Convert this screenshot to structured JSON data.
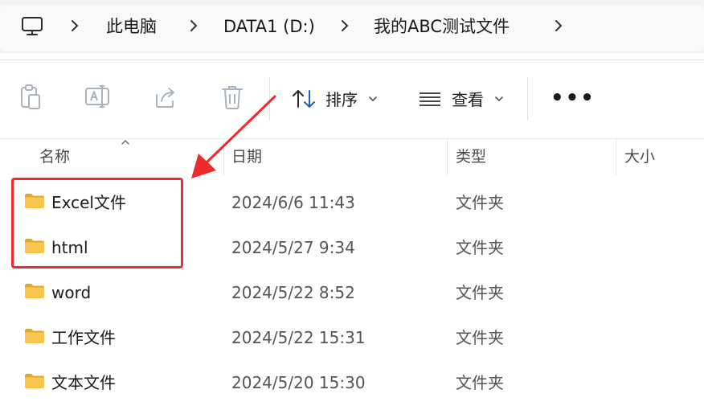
{
  "breadcrumb": {
    "items": [
      "此电脑",
      "DATA1 (D:)",
      "我的ABC测试文件"
    ]
  },
  "toolbar": {
    "sort_label": "排序",
    "view_label": "查看",
    "more_label": "•••"
  },
  "columns": {
    "name": "名称",
    "date": "日期",
    "type": "类型",
    "size": "大小"
  },
  "files": [
    {
      "name": "Excel文件",
      "date": "2024/6/6 11:43",
      "type": "文件夹"
    },
    {
      "name": "html",
      "date": "2024/5/27 9:34",
      "type": "文件夹"
    },
    {
      "name": "word",
      "date": "2024/5/22 8:52",
      "type": "文件夹"
    },
    {
      "name": "工作文件",
      "date": "2024/5/22 15:31",
      "type": "文件夹"
    },
    {
      "name": "文本文件",
      "date": "2024/5/20 15:30",
      "type": "文件夹"
    }
  ],
  "colors": {
    "folder": "#f6c64e",
    "folder_tab": "#e3a82b",
    "annotation": "#ee2a2a",
    "disabled_icon": "#a9b3bd",
    "accent_blue": "#1a62b8"
  }
}
